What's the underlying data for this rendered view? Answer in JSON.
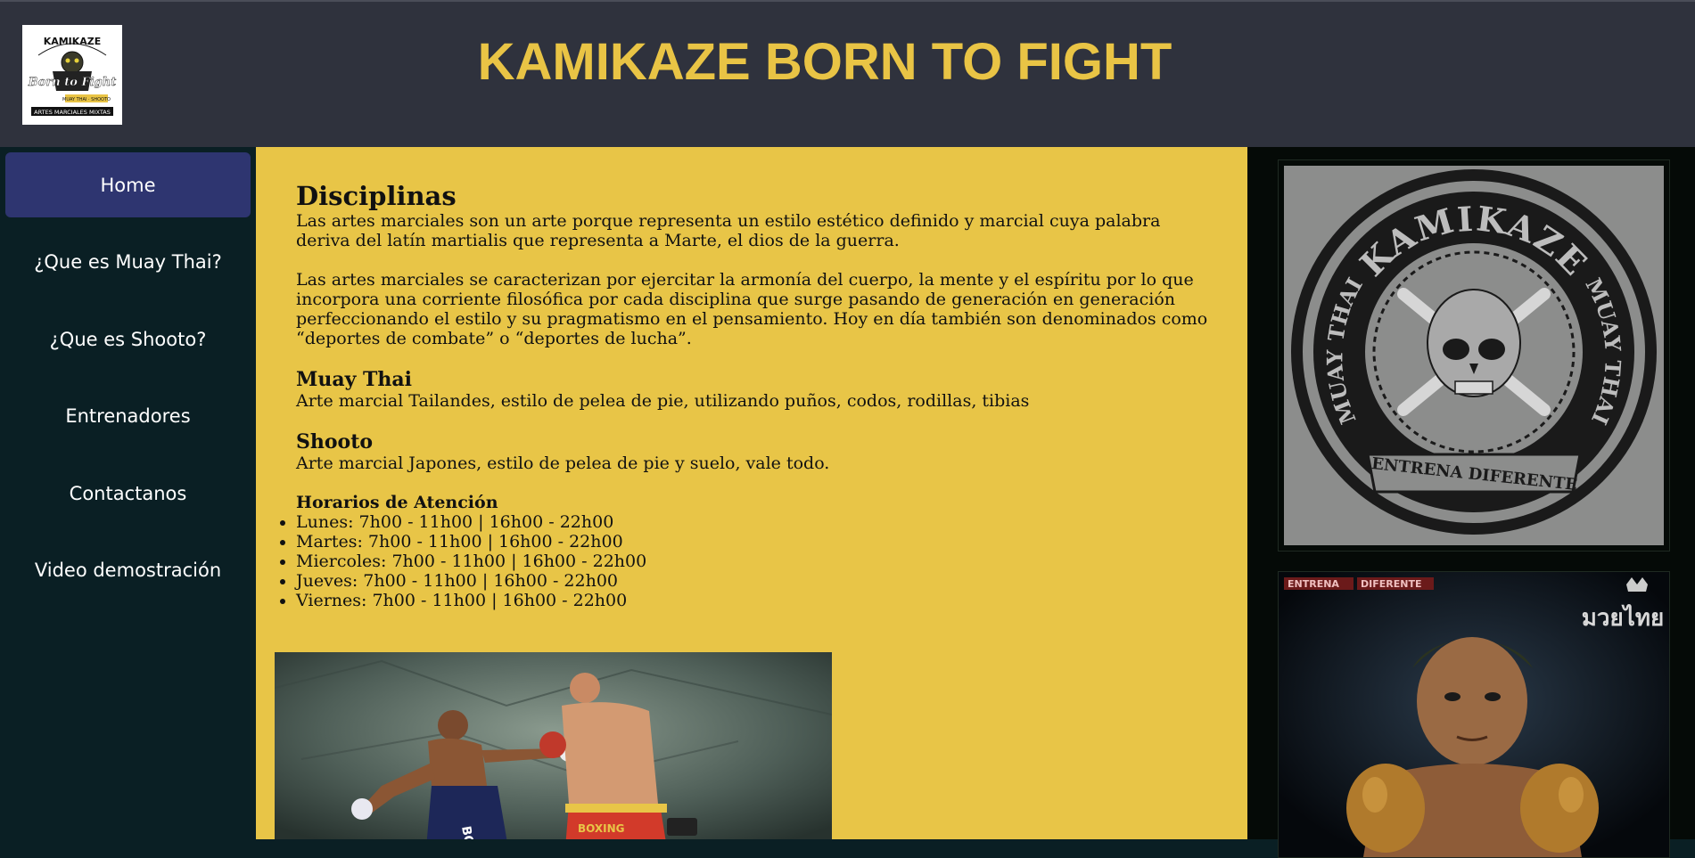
{
  "header": {
    "title": "KAMIKAZE BORN TO FIGHT",
    "logo": {
      "text_top": "KAMIKAZE",
      "text_middle": "Born to Fight",
      "text_small": "MUAY THAI · SHOOTO",
      "text_bottom": "ARTES MARCIALES MIXTAS"
    }
  },
  "nav": {
    "items": [
      {
        "label": "Home",
        "active": true
      },
      {
        "label": "¿Que es Muay Thai?",
        "active": false
      },
      {
        "label": "¿Que es Shooto?",
        "active": false
      },
      {
        "label": "Entrenadores",
        "active": false
      },
      {
        "label": "Contactanos",
        "active": false
      },
      {
        "label": "Video demostración",
        "active": false
      }
    ]
  },
  "main": {
    "heading": "Disciplinas",
    "paragraph1": "Las artes marciales son un arte porque representa un estilo estético definido y marcial cuya palabra deriva del latín martialis que representa a Marte, el dios de la guerra.",
    "paragraph2": "Las artes marciales se caracterizan por ejercitar la armonía del cuerpo, la mente y el espíritu por lo que incorpora una corriente filosófica por cada disciplina que surge pasando de generación en generación perfeccionando el estilo y su pragmatismo en el pensamiento. Hoy en día también son denominados como “deportes de combate” o “deportes de lucha”.",
    "muay_thai": {
      "title": "Muay Thai",
      "text": "Arte marcial Tailandes, estilo de pelea de pie, utilizando puños, codos, rodillas, tibias"
    },
    "shooto": {
      "title": "Shooto",
      "text": "Arte marcial Japones, estilo de pelea de pie y suelo, vale todo."
    },
    "schedule": {
      "title": "Horarios de Atención",
      "days": [
        "Lunes: 7h00 - 11h00 | 16h00 - 22h00",
        "Martes: 7h00 - 11h00 | 16h00 - 22h00",
        "Miercoles: 7h00 - 11h00 | 16h00 - 22h00",
        "Jueves: 7h00 - 11h00 | 16h00 - 22h00",
        "Viernes: 7h00 - 11h00 | 16h00 - 22h00"
      ]
    },
    "photo_texts": {
      "short_left": "BOXING",
      "short_right": "BOXING"
    }
  },
  "aside": {
    "card1": {
      "ring_top": "KAMIKAZE",
      "ring_left": "MUAY THAI",
      "ring_right": "MUAY THAI",
      "banner": "ENTRENA DIFERENTE"
    },
    "card2": {
      "tag1": "ENTRENA",
      "tag2": "DIFERENTE",
      "script": "มวยไทย"
    }
  },
  "colors": {
    "header_bg": "#2f323d",
    "title": "#e9c445",
    "sidebar_bg": "#0a1f24",
    "nav_active": "#2e3570",
    "main_bg": "#e8c547",
    "aside_bg": "#050a07"
  }
}
